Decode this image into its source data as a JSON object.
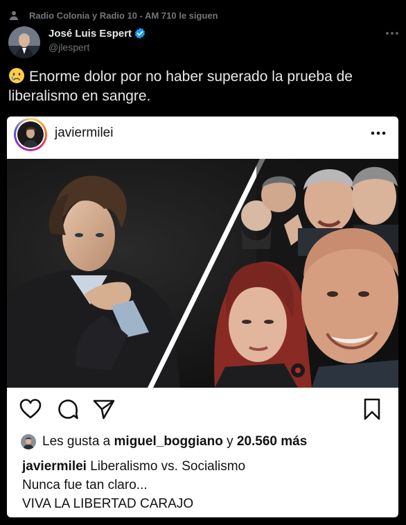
{
  "social_context": {
    "text": "Radio Colonia y Radio 10 - AM 710 le siguen",
    "icon": "person-icon"
  },
  "tweet": {
    "author_name": "José Luis Espert",
    "author_handle": "@jlespert",
    "verified": true,
    "emoji": "crying-face",
    "text": "Enorme dolor por no haber superado la prueba de liberalismo en sangre."
  },
  "instagram": {
    "username": "javiermilei",
    "likes": {
      "prefix": "Les gusta a",
      "user": "miguel_boggiano",
      "connector": "y",
      "count": "20.560 más"
    },
    "caption": {
      "user": "javiermilei",
      "line1": "Liberalismo vs. Socialismo",
      "line2": "Nunca fue tan claro...",
      "line3": "VIVA LA LIBERTAD CARAJO"
    }
  },
  "colors": {
    "background": "#000000",
    "text": "#e7e9ea",
    "muted": "#71767b",
    "verified": "#1d9bf0",
    "card": "#ffffff"
  }
}
